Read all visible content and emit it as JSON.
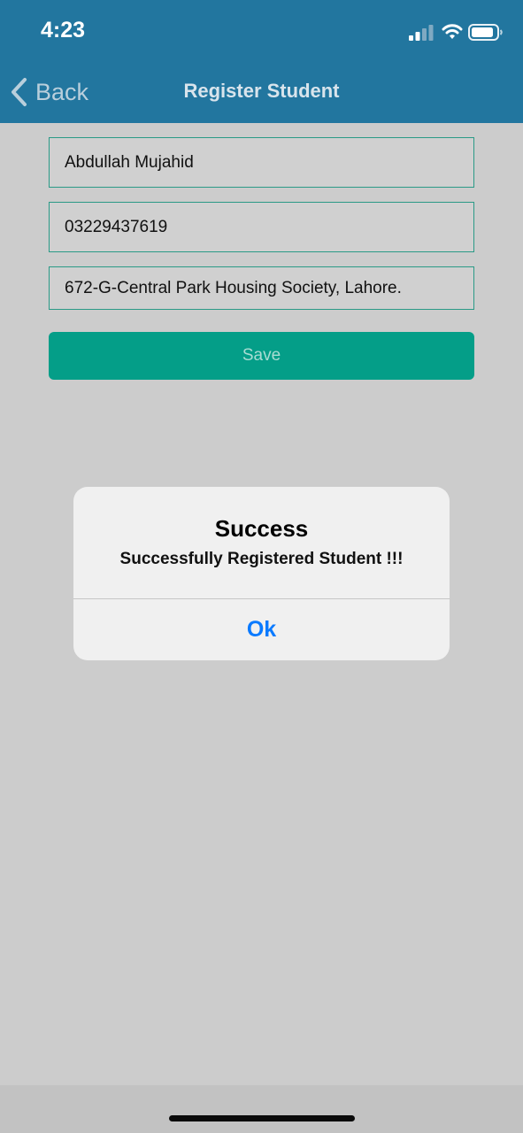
{
  "status_bar": {
    "time": "4:23"
  },
  "nav": {
    "back_label": "Back",
    "title": "Register Student"
  },
  "form": {
    "name_value": "Abdullah Mujahid",
    "phone_value": "03229437619",
    "address_value": "672-G-Central Park Housing Society, Lahore.",
    "save_label": "Save"
  },
  "alert": {
    "title": "Success",
    "message": "Successfully Registered Student !!!",
    "ok_label": "Ok"
  },
  "colors": {
    "header": "#22769f",
    "accent": "#049e88",
    "field_border": "#2a9a86",
    "link_blue": "#0a7aff",
    "background": "#cccccc"
  },
  "icons": [
    "chevron-left-icon",
    "cellular-signal-icon",
    "wifi-icon",
    "battery-icon"
  ]
}
